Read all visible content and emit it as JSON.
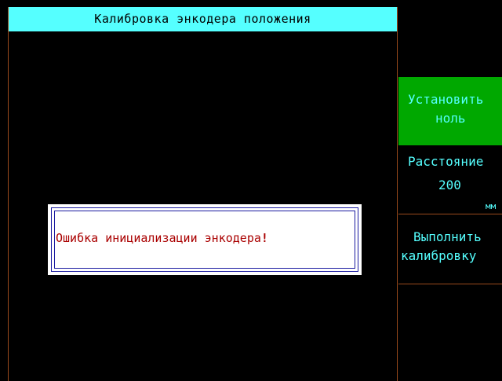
{
  "title": "Калибровка энкодера положения",
  "error": {
    "message": "Ошибка инициализации энкодера",
    "mark": "!"
  },
  "side_buttons": {
    "set_zero": {
      "line1": "Установить",
      "line2": "ноль"
    },
    "distance": {
      "label": "Расстояние",
      "value": "200",
      "unit": "мм"
    },
    "calibrate": {
      "line1": "Выполнить",
      "line2": "калибровку"
    }
  },
  "colors": {
    "title_bg": "#55ffff",
    "accent_text": "#55ffff",
    "active_button_bg": "#00a800",
    "error_text": "#aa0000",
    "dialog_border": "#1a1aa0",
    "divider": "#9a4a1c"
  }
}
